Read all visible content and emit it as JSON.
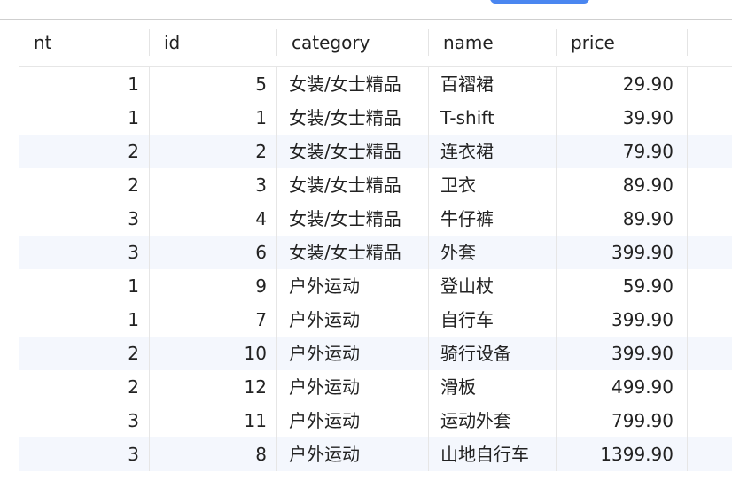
{
  "columns": {
    "nt": "nt",
    "id": "id",
    "category": "category",
    "name": "name",
    "price": "price"
  },
  "rows": [
    {
      "nt": "1",
      "id": "5",
      "category": "女装/女士精品",
      "name": "百褶裙",
      "price": "29.90"
    },
    {
      "nt": "1",
      "id": "1",
      "category": "女装/女士精品",
      "name": "T-shift",
      "price": "39.90"
    },
    {
      "nt": "2",
      "id": "2",
      "category": "女装/女士精品",
      "name": "连衣裙",
      "price": "79.90"
    },
    {
      "nt": "2",
      "id": "3",
      "category": "女装/女士精品",
      "name": "卫衣",
      "price": "89.90"
    },
    {
      "nt": "3",
      "id": "4",
      "category": "女装/女士精品",
      "name": "牛仔裤",
      "price": "89.90"
    },
    {
      "nt": "3",
      "id": "6",
      "category": "女装/女士精品",
      "name": "外套",
      "price": "399.90"
    },
    {
      "nt": "1",
      "id": "9",
      "category": "户外运动",
      "name": "登山杖",
      "price": "59.90"
    },
    {
      "nt": "1",
      "id": "7",
      "category": "户外运动",
      "name": "自行车",
      "price": "399.90"
    },
    {
      "nt": "2",
      "id": "10",
      "category": "户外运动",
      "name": "骑行设备",
      "price": "399.90"
    },
    {
      "nt": "2",
      "id": "12",
      "category": "户外运动",
      "name": "滑板",
      "price": "499.90"
    },
    {
      "nt": "3",
      "id": "11",
      "category": "户外运动",
      "name": "运动外套",
      "price": "799.90"
    },
    {
      "nt": "3",
      "id": "8",
      "category": "户外运动",
      "name": "山地自行车",
      "price": "1399.90"
    }
  ],
  "colors": {
    "accent": "#4a86f0",
    "row_alt": "#f4f7fd"
  }
}
